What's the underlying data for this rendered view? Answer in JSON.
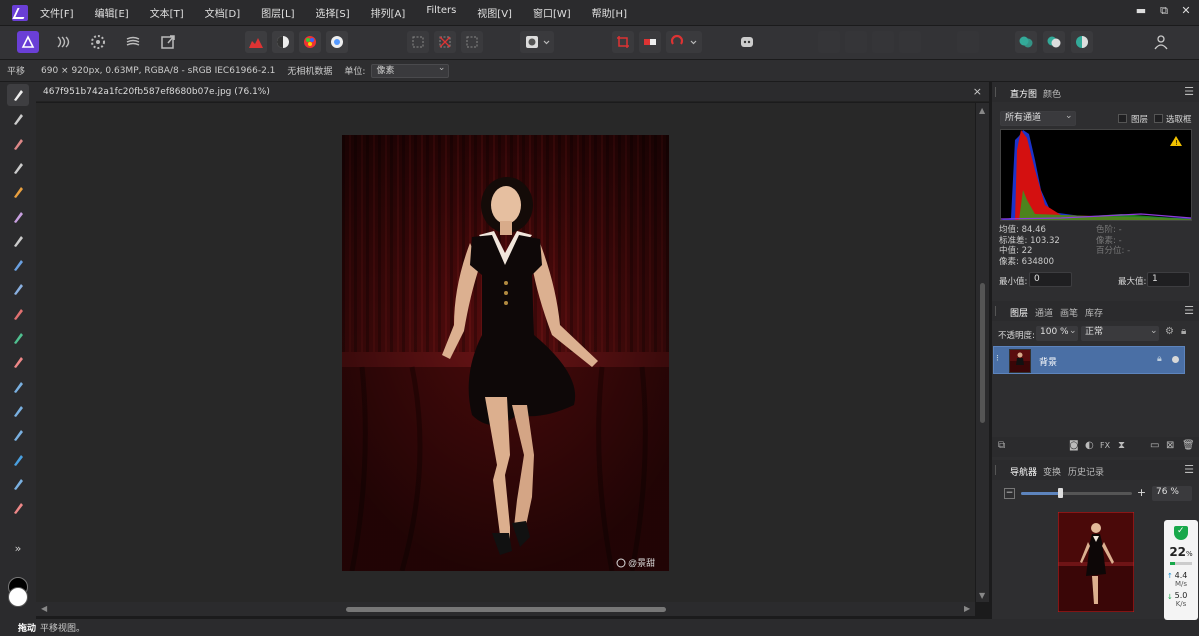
{
  "menu": [
    "文件[F]",
    "编辑[E]",
    "文本[T]",
    "文档[D]",
    "图层[L]",
    "选择[S]",
    "排列[A]",
    "Filters",
    "视图[V]",
    "窗口[W]",
    "帮助[H]"
  ],
  "window_controls": {
    "minimize": "▬",
    "restore": "⧉",
    "close": "✕"
  },
  "context": {
    "tool_name": "平移",
    "image_info": "690 × 920px, 0.63MP, RGBA/8 - sRGB IEC61966-2.1",
    "camera": "无相机数据",
    "unit_label": "单位:",
    "unit_value": "像素"
  },
  "document": {
    "tab_title": "467f951b742a1fc20fb587ef8680b07e.jpg (76.1%)",
    "close": "×",
    "watermark": "@景甜"
  },
  "status": {
    "bold": "拖动",
    "text": "平移视图。"
  },
  "histogram_panel": {
    "tabs": [
      "直方图",
      "颜色"
    ],
    "channel": "所有通道",
    "layer_check": "图层",
    "marquee_check": "选取框",
    "stats_left": [
      "均值: 84.46",
      "标准差: 103.32",
      "中值: 22",
      "像素: 634800"
    ],
    "stats_right": [
      "色阶: -",
      "像素: -",
      "百分位: -"
    ],
    "min_label": "最小值:",
    "min_value": "0",
    "max_label": "最大值:",
    "max_value": "1"
  },
  "layers_panel": {
    "tabs": [
      "图层",
      "通道",
      "画笔",
      "库存"
    ],
    "opacity_label": "不透明度:",
    "opacity_value": "100 %",
    "blend_mode": "正常",
    "layer_name": "背景"
  },
  "navigator_panel": {
    "tabs": [
      "导航器",
      "变换",
      "历史记录"
    ],
    "zoom_value": "76 %",
    "zoom_fraction": 0.35
  },
  "net_monitor": {
    "percent": "22",
    "percent_unit": "%",
    "up": "4.4",
    "up_unit": "M/s",
    "down": "5.0",
    "down_unit": "K/s"
  },
  "colors": {
    "accent": "#4a6fa5",
    "brand": "#6a3fd6",
    "curtain": "#5a0d0e",
    "warning": "#f2c200"
  }
}
